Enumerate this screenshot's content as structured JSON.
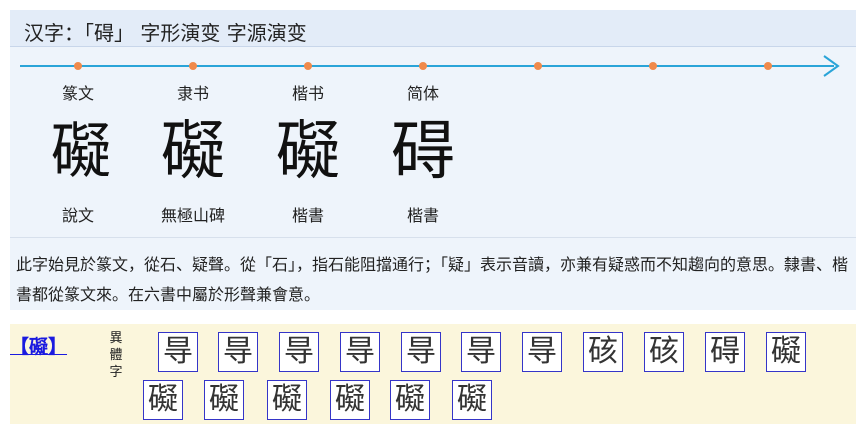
{
  "header": {
    "title": "汉字：「碍」 字形演变 字源演变"
  },
  "stages": [
    {
      "label": "篆文",
      "glyph": "礙",
      "source": "說文"
    },
    {
      "label": "隶书",
      "glyph": "礙",
      "source": "無極山碑"
    },
    {
      "label": "楷书",
      "glyph": "礙",
      "source": "楷書"
    },
    {
      "label": "简体",
      "glyph": "碍",
      "source": "楷書"
    }
  ],
  "description": "此字始見於篆文，從石、疑聲。從「石」，指石能阻擋通行；「疑」表示音讀，亦兼有疑惑而不知趨向的意思。隸書、楷書都從篆文來。在六書中屬於形聲兼會意。",
  "variants": {
    "head": "【礙】",
    "label": "異體字",
    "chars": [
      "㝵",
      "㝵",
      "㝵",
      "㝵",
      "㝵",
      "㝵",
      "㝵",
      "硋",
      "硋",
      "碍",
      "礙",
      "礙",
      "礙",
      "礙",
      "礙",
      "礙",
      "礙"
    ]
  },
  "colors": {
    "timeline": "#2aa4d8",
    "dot": "#f08a4b",
    "link": "#1a1ae0",
    "variant_border": "#3535c8"
  }
}
